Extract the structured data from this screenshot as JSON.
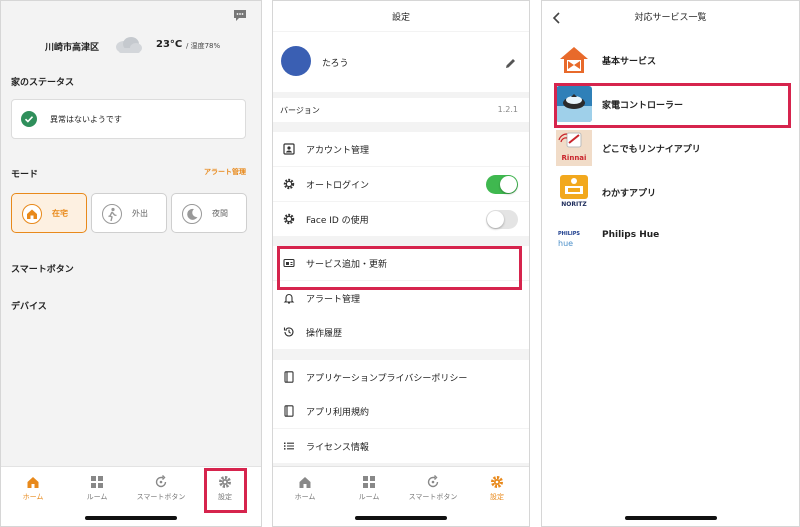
{
  "colors": {
    "accent": "#e8891b",
    "toggle_on": "#3fb84f",
    "highlight": "#d6244d",
    "ok_green": "#2f8f5b"
  },
  "home": {
    "location": "川崎市高津区",
    "temperature": "23°C",
    "humidity": "/ 湿度78%",
    "home_status_title": "家のステータス",
    "status_message": "異常はないようです",
    "mode_title": "モード",
    "alert_link": "アラート管理",
    "modes": [
      {
        "label": "在宅",
        "icon": "home-icon",
        "selected": true
      },
      {
        "label": "外出",
        "icon": "walking-person-icon",
        "selected": false
      },
      {
        "label": "夜間",
        "icon": "moon-icon",
        "selected": false
      }
    ],
    "smart_button_title": "スマートボタン",
    "devices_title": "デバイス"
  },
  "tabs": [
    {
      "label": "ホーム",
      "icon": "home-icon"
    },
    {
      "label": "ルーム",
      "icon": "grid-icon"
    },
    {
      "label": "スマートボタン",
      "icon": "refresh-icon"
    },
    {
      "label": "設定",
      "icon": "gear-icon"
    }
  ],
  "settings": {
    "title": "設定",
    "user_name": "たろう",
    "version_label": "バージョン",
    "version": "1.2.1",
    "items": [
      {
        "label": "アカウント管理",
        "icon": "account-card-icon"
      },
      {
        "label": "オートログイン",
        "icon": "gear-icon",
        "toggle": true
      },
      {
        "label": "Face ID の使用",
        "icon": "gear-icon",
        "toggle": false
      },
      {
        "label": "サービス追加・更新",
        "icon": "service-icon"
      },
      {
        "label": "アラート管理",
        "icon": "bell-icon"
      },
      {
        "label": "操作履歴",
        "icon": "history-icon"
      },
      {
        "label": "アプリケーションプライバシーポリシー",
        "icon": "document-icon"
      },
      {
        "label": "アプリ利用規約",
        "icon": "document-icon"
      },
      {
        "label": "ライセンス情報",
        "icon": "list-icon"
      }
    ]
  },
  "services": {
    "title": "対応サービス一覧",
    "items": [
      {
        "name": "基本サービス",
        "logo": "basic-service-logo"
      },
      {
        "name": "家電コントローラー",
        "logo": "appliance-controller-logo"
      },
      {
        "name": "どこでもリンナイアプリ",
        "logo": "rinnai-logo",
        "logo_text": "Rinnai"
      },
      {
        "name": "わかすアプリ",
        "logo": "noritz-logo",
        "logo_text": "NORITZ"
      },
      {
        "name": "Philips Hue",
        "logo": "philips-hue-logo",
        "logo_text": "PHILIPS",
        "logo_subtext": "hue"
      }
    ]
  }
}
